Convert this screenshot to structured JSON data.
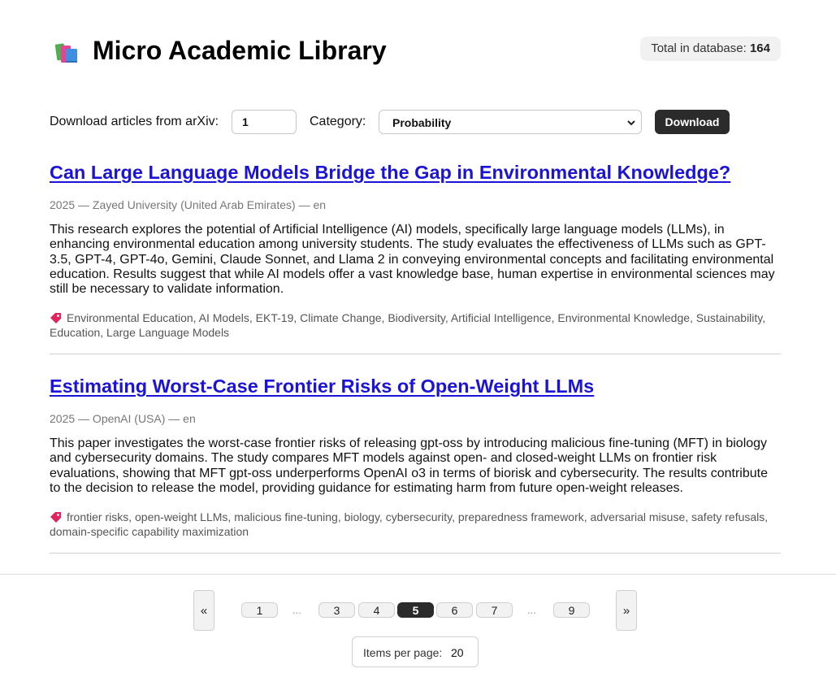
{
  "header": {
    "title": "Micro Academic Library",
    "logo_icon": "books-icon",
    "total_label": "Total in database:",
    "total_count": "164"
  },
  "download_bar": {
    "label": "Download articles from arXiv:",
    "count_value": "1",
    "category_label": "Category:",
    "category_selected": "Probability",
    "button_label": "Download"
  },
  "articles": [
    {
      "title": "Can Large Language Models Bridge the Gap in Environmental Knowledge?",
      "meta": "2025 — Zayed University (United Arab Emirates) — en",
      "abstract": "This research explores the potential of Artificial Intelligence (AI) models, specifically large language models (LLMs), in enhancing environmental education among university students. The study evaluates the effectiveness of LLMs such as GPT-3.5, GPT-4, GPT-4o, Gemini, Claude Sonnet, and Llama 2 in conveying environmental concepts and facilitating environmental education. Results suggest that while AI models offer a vast knowledge base, human expertise in environmental sciences may still be necessary to validate information.",
      "keywords": "Environmental Education, AI Models, EKT-19, Climate Change, Biodiversity, Artificial Intelligence, Environmental Knowledge, Sustainability, Education, Large Language Models"
    },
    {
      "title": "Estimating Worst-Case Frontier Risks of Open-Weight LLMs",
      "meta": "2025 — OpenAI (USA) — en",
      "abstract": "This paper investigates the worst-case frontier risks of releasing gpt-oss by introducing malicious fine-tuning (MFT) in biology and cybersecurity domains. The study compares MFT models against open- and closed-weight LLMs on frontier risk evaluations, showing that MFT gpt-oss underperforms OpenAI o3 in terms of biorisk and cybersecurity. The results contribute to the decision to release the model, providing guidance for estimating harm from future open-weight releases.",
      "keywords": "frontier risks, open-weight LLMs, malicious fine-tuning, biology, cybersecurity, preparedness framework, adversarial misuse, safety refusals, domain-specific capability maximization"
    }
  ],
  "pagination": {
    "prev_label": "«",
    "next_label": "»",
    "ellipsis": "...",
    "pages": [
      "1",
      "3",
      "4",
      "5",
      "6",
      "7",
      "9"
    ],
    "current_page": "5",
    "per_page_label": "Items per page:",
    "per_page_value": "20"
  },
  "colors": {
    "link": "#1b14d8",
    "dark_button": "#2b2b2b",
    "tag_icon": "#e0245e"
  }
}
